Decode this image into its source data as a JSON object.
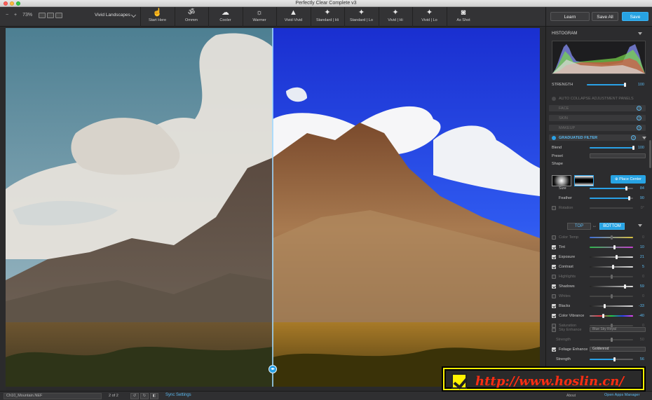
{
  "window": {
    "title": "Perfectly Clear Complete v3"
  },
  "toolbar": {
    "zoom_out": "−",
    "zoom_in": "+",
    "zoom": "73%",
    "preset_name": "Vivid Landscapes",
    "presets": [
      {
        "label": "Start Here",
        "icon": "hand-pointer-icon",
        "glyph": "☝"
      },
      {
        "label": "Ommm",
        "icon": "om-icon",
        "glyph": "ॐ"
      },
      {
        "label": "Cooler",
        "icon": "cloud-icon",
        "glyph": "☁"
      },
      {
        "label": "Warmer",
        "icon": "sun-icon",
        "glyph": "☼"
      },
      {
        "label": "Vivid-Vivid",
        "icon": "landscape-icon",
        "glyph": "▲"
      },
      {
        "label": "Standard | Hi",
        "icon": "wand-icon",
        "glyph": "✦"
      },
      {
        "label": "Standard | Lo",
        "icon": "wand-icon",
        "glyph": "✦"
      },
      {
        "label": "Vivid | Hi",
        "icon": "wand-icon",
        "glyph": "✦"
      },
      {
        "label": "Vivid | Lo",
        "icon": "wand-icon",
        "glyph": "✦"
      },
      {
        "label": "As Shot",
        "icon": "camera-icon",
        "glyph": "◙"
      }
    ]
  },
  "header": {
    "learn": "Learn",
    "save_all": "Save All",
    "save": "Save"
  },
  "panel": {
    "histogram": "HISTOGRAM",
    "strength_label": "STRENGTH",
    "strength_value": "100",
    "strength_level": 100,
    "auto_collapse": "AUTO COLLAPSE ADJUSTMENT PANELS",
    "face": "FACE",
    "skin": "SKIN",
    "makeup": "MAKEUP",
    "graduated_filter": "GRADUATED FILTER",
    "help": "?",
    "blend_label": "Blend",
    "blend_value": "100",
    "blend_level": 100,
    "preset_label": "Preset",
    "shape_label": "Shape",
    "place_center": "Place Center",
    "size_label": "Size",
    "size_value": "84",
    "size_level": 84,
    "feather_label": "Feather",
    "feather_value": "90",
    "feather_level": 90,
    "rotation_label": "Rotation",
    "rotation_value": "0°",
    "tab_top": "TOP",
    "tab_bottom": "BOTTOM",
    "adjustments": [
      {
        "label": "Color Temp",
        "value": "0",
        "level": 50,
        "enabled": false
      },
      {
        "label": "Tint",
        "value": "10",
        "level": 56,
        "enabled": true
      },
      {
        "label": "Exposure",
        "value": "21",
        "level": 62,
        "enabled": true
      },
      {
        "label": "Contrast",
        "value": "5",
        "level": 53,
        "enabled": true
      },
      {
        "label": "Highlights",
        "value": "0",
        "level": 50,
        "enabled": false
      },
      {
        "label": "Shadows",
        "value": "59",
        "level": 80,
        "enabled": true
      },
      {
        "label": "Whites",
        "value": "0",
        "level": 50,
        "enabled": false
      },
      {
        "label": "Blacks",
        "value": "-33",
        "level": 34,
        "enabled": true
      },
      {
        "label": "Color Vibrance",
        "value": "-40",
        "level": 30,
        "enabled": true
      },
      {
        "label": "Saturation",
        "value": "0",
        "level": 50,
        "enabled": false
      }
    ],
    "sky_enhance": "Sky Enhance",
    "sky_preset": "Blue Sky Royal",
    "sky_strength_label": "Strength",
    "sky_strength_value": "50",
    "sky_strength_level": 50,
    "foliage_enhance": "Foliage Enhance",
    "foliage_preset": "Goldenrod",
    "foliage_strength_label": "Strength",
    "foliage_strength_value": "56",
    "foliage_strength_level": 56
  },
  "status": {
    "filename": "Ch10_Mountain.NEF",
    "pager": "2 of 2",
    "sync": "Sync Settings",
    "about": "About",
    "apps": "Open Apps Manager"
  },
  "watermark": {
    "text": "http://www.hoslin.cn/"
  },
  "colors": {
    "accent": "#27a3e3",
    "window_bg": "#2c2c2e"
  }
}
